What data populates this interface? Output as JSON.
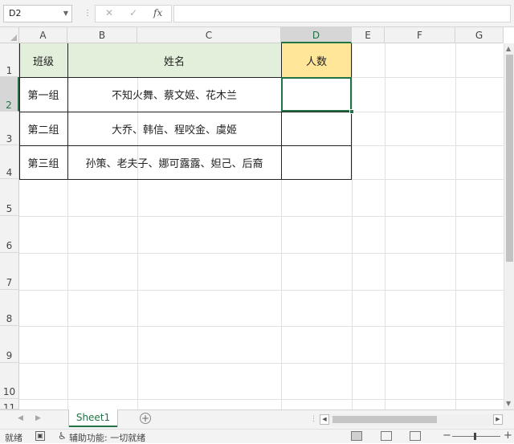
{
  "formula_bar": {
    "name_box": "D2",
    "cancel_glyph": "✕",
    "enter_glyph": "✓",
    "fx_label": "fx",
    "formula": ""
  },
  "columns": [
    "A",
    "B",
    "C",
    "D",
    "E",
    "F",
    "G"
  ],
  "selected_column": "D",
  "rows": [
    "1",
    "2",
    "3",
    "4",
    "5",
    "6",
    "7",
    "8",
    "9",
    "10",
    "11"
  ],
  "selected_row": "2",
  "table": {
    "headers": [
      "班级",
      "姓名",
      "人数"
    ],
    "rows": [
      {
        "class": "第一组",
        "names": "不知火舞、蔡文姬、花木兰",
        "count": ""
      },
      {
        "class": "第二组",
        "names": "大乔、韩信、程咬金、虞姬",
        "count": ""
      },
      {
        "class": "第三组",
        "names": "孙策、老夫子、娜可露露、妲己、后裔",
        "count": ""
      }
    ]
  },
  "colors": {
    "header_green": "#e2efda",
    "header_yellow": "#ffe699",
    "accent": "#217346"
  },
  "sheet_tabs": [
    {
      "label": "Sheet1",
      "active": true
    }
  ],
  "status": {
    "ready": "就绪",
    "accessibility": "辅助功能: 一切就绪"
  },
  "icons": {
    "add_sheet": "plus-circle-icon",
    "macro": "macro-record-icon",
    "accessibility": "accessibility-icon"
  }
}
